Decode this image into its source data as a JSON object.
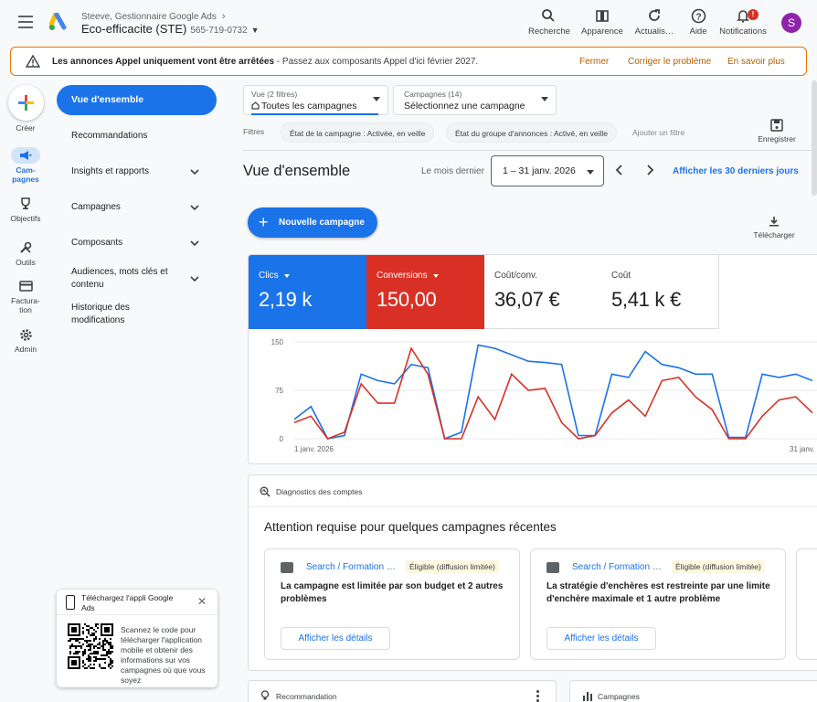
{
  "header": {
    "breadcrumb": "Steeve, Gestionnaire Google Ads",
    "account_name": "Eco-efficacite (STE)",
    "account_id": "565-719-0732",
    "avatar_letter": "S",
    "notification_count": "!",
    "tools": [
      {
        "label": "Recherche",
        "icon": "search-icon"
      },
      {
        "label": "Apparence",
        "icon": "appearance-icon"
      },
      {
        "label": "Actualis…",
        "icon": "refresh-icon"
      },
      {
        "label": "Aide",
        "icon": "help-icon"
      },
      {
        "label": "Notifications",
        "icon": "bell-icon"
      }
    ]
  },
  "alert": {
    "text_bold": "Les annonces Appel uniquement vont être arrêtées",
    "text_rest": " - Passez aux composants Appel d'ici février 2027.",
    "actions": [
      "Fermer",
      "Corriger le problème",
      "En savoir plus"
    ]
  },
  "rail": {
    "create_label": "Créer",
    "items": [
      {
        "label": "Cam-\npagnes",
        "icon": "campaigns-icon",
        "active": true
      },
      {
        "label": "Objectifs",
        "icon": "trophy-icon",
        "active": false
      },
      {
        "label": "Outils",
        "icon": "tools-icon",
        "active": false
      },
      {
        "label": "Factura-\ntion",
        "icon": "billing-icon",
        "active": false
      },
      {
        "label": "Admin",
        "icon": "gear-icon",
        "active": false
      }
    ]
  },
  "sidenav": {
    "active": "Vue d'ensemble",
    "items": [
      {
        "label": "Recommandations",
        "expandable": false
      },
      {
        "label": "Insights et rapports",
        "expandable": true
      },
      {
        "label": "Campagnes",
        "expandable": true
      },
      {
        "label": "Composants",
        "expandable": true
      },
      {
        "label": "Audiences, mots clés et contenu",
        "expandable": true
      },
      {
        "label": "Historique des modifications",
        "expandable": false
      }
    ]
  },
  "filterbar": {
    "view_small": "Vue (2 filtres)",
    "view_main": "Toutes les campagnes",
    "campaigns_small": "Campagnes (14)",
    "campaigns_main": "Sélectionnez une campagne",
    "filters_label": "Filtres",
    "chips": [
      "État de la campagne : Activée, en veille",
      "État du groupe d'annonces : Activé, en veille"
    ],
    "add_filter": "Ajouter un filtre",
    "save_label": "Enregistrer"
  },
  "overview": {
    "title": "Vue d'ensemble",
    "period_label": "Le mois dernier",
    "date_range": "1 – 31 janv. 2026",
    "show_30": "Afficher les 30 derniers jours",
    "new_campaign": "Nouvelle campagne",
    "download": "Télécharger"
  },
  "metrics": [
    {
      "name": "Clics",
      "value": "2,19 k",
      "color": "#1a73e8",
      "dropdown": true
    },
    {
      "name": "Conversions",
      "value": "150,00",
      "color": "#d93025",
      "dropdown": true
    },
    {
      "name": "Coût/conv.",
      "value": "36,07 €",
      "color": "#ffffff",
      "dropdown": false
    },
    {
      "name": "Coût",
      "value": "5,41 k €",
      "color": "#ffffff",
      "dropdown": false
    }
  ],
  "chart_data": {
    "type": "line",
    "x_labels": [
      "1 janv. 2026",
      "31 janv."
    ],
    "y_ticks": [
      0,
      75,
      150
    ],
    "ylim": [
      0,
      150
    ],
    "grid": true,
    "series": [
      {
        "name": "Clics",
        "color": "#1a73e8",
        "values": [
          30,
          50,
          0,
          5,
          100,
          90,
          85,
          115,
          110,
          0,
          10,
          145,
          140,
          130,
          120,
          118,
          115,
          5,
          5,
          100,
          95,
          135,
          115,
          110,
          100,
          100,
          2,
          2,
          100,
          95,
          100,
          90
        ]
      },
      {
        "name": "Conversions",
        "color": "#d93025",
        "values": [
          25,
          35,
          0,
          10,
          85,
          55,
          55,
          140,
          100,
          0,
          0,
          65,
          30,
          100,
          75,
          78,
          25,
          0,
          5,
          40,
          60,
          35,
          90,
          95,
          65,
          45,
          0,
          0,
          35,
          60,
          65,
          40
        ]
      }
    ]
  },
  "diagnostics": {
    "header": "Diagnostics des comptes",
    "title": "Attention requise pour quelques campagnes récentes",
    "issues": [
      {
        "campaign": "Search / Formation R…",
        "status": "Éligible (diffusion limitée)",
        "desc": "La campagne est limitée par son budget et 2 autres problèmes",
        "action": "Afficher les détails"
      },
      {
        "campaign": "Search / Formation R…",
        "status": "Éligible (diffusion limitée)",
        "desc": "La stratégie d'enchères est restreinte par une limite d'enchère maximale et 1 autre problème",
        "action": "Afficher les détails"
      }
    ]
  },
  "bottom_cards": [
    "Recommandation",
    "Campagnes"
  ],
  "popup": {
    "title": "Téléchargez l'appli Google Ads",
    "text": "Scannez le code pour télécharger l'application mobile et obtenir des informations sur vos campagnes où que vous soyez"
  }
}
